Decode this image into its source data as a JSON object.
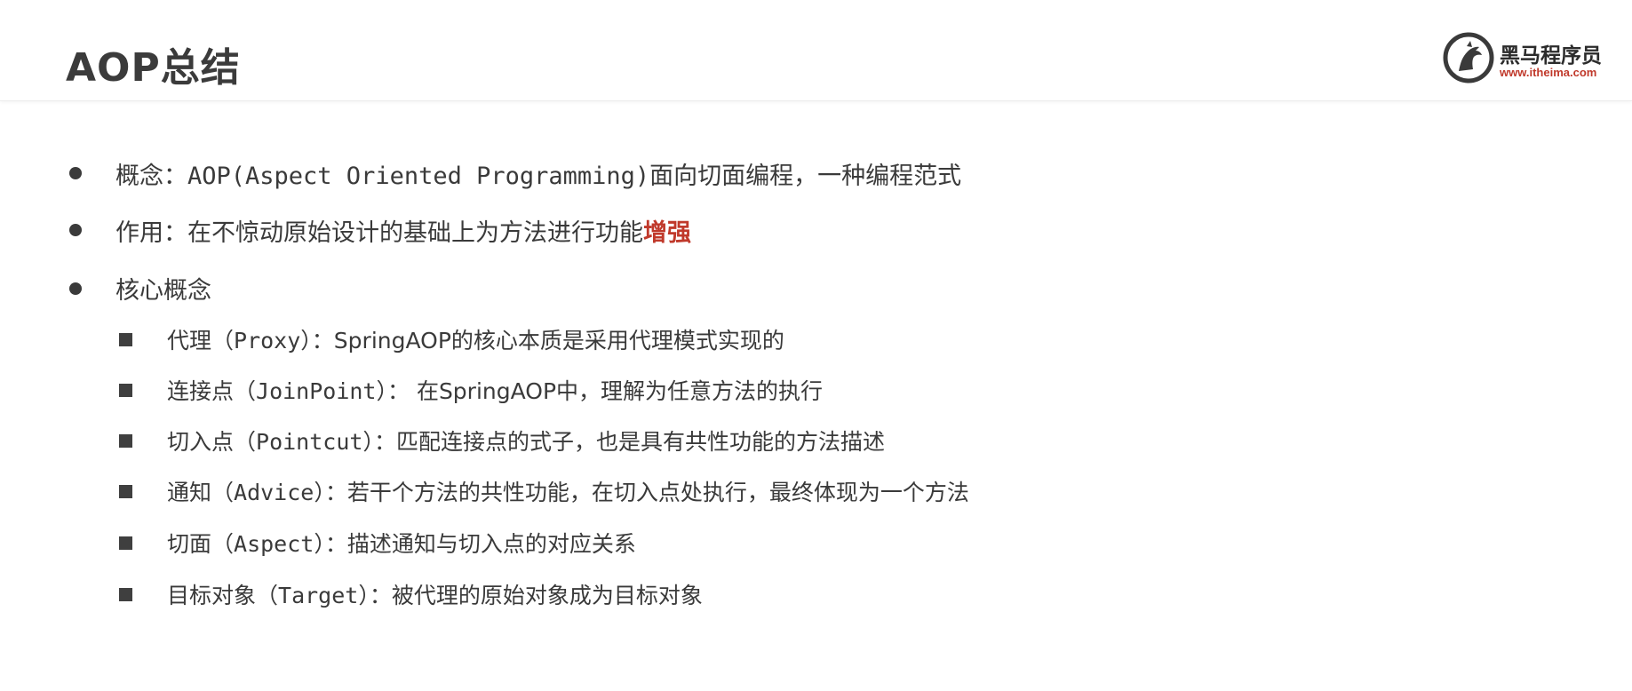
{
  "slide": {
    "title": "AOP总结"
  },
  "logo": {
    "name": "黑马程序员",
    "url": "www.itheima.com",
    "icon": "horse-head-icon"
  },
  "bullets": [
    {
      "label": "概念：",
      "mono": "AOP(Aspect Oriented Programming)",
      "text": "面向切面编程，一种编程范式"
    },
    {
      "label": "作用：",
      "text": "在不惊动原始设计的基础上为方法进行功能",
      "emphasis": "增强"
    },
    {
      "label": "核心概念"
    }
  ],
  "core_concepts": [
    {
      "name": "代理",
      "term": "（Proxy）",
      "sep": "：",
      "desc": "SpringAOP的核心本质是采用代理模式实现的"
    },
    {
      "name": "连接点",
      "term": "（JoinPoint）",
      "sep": "： ",
      "desc": "在SpringAOP中，理解为任意方法的执行"
    },
    {
      "name": "切入点",
      "term": "（Pointcut）",
      "sep": "：",
      "desc": "匹配连接点的式子，也是具有共性功能的方法描述"
    },
    {
      "name": "通知",
      "term": "（Advice）",
      "sep": "：",
      "desc": "若干个方法的共性功能，在切入点处执行，最终体现为一个方法"
    },
    {
      "name": "切面",
      "term": "（Aspect）",
      "sep": "：",
      "desc": "描述通知与切入点的对应关系"
    },
    {
      "name": "目标对象",
      "term": "（Target）",
      "sep": "：",
      "desc": "被代理的原始对象成为目标对象"
    }
  ],
  "colors": {
    "accent": "#c0392b",
    "text": "#3a3a3a"
  }
}
